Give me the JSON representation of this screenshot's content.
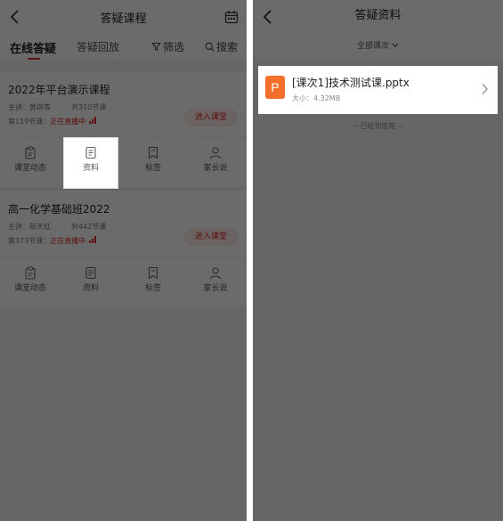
{
  "left": {
    "title": "答疑课程",
    "tabs": [
      "在线答疑",
      "答疑回放"
    ],
    "filter_label": "筛选",
    "search_label": "搜索",
    "courses": [
      {
        "title": "2022年平台演示课程",
        "teacher": "主讲：黄辟等",
        "total": "共310节课",
        "lesson": "第119节课：",
        "live": "正在直播中",
        "enter": "进入课堂"
      },
      {
        "title": "高一化学基础班2022",
        "teacher": "主讲：陈天虹",
        "total": "共442节课",
        "lesson": "第373节课：",
        "live": "正在直播中",
        "enter": "进入课堂"
      }
    ],
    "actions": [
      "课堂动态",
      "资料",
      "标签",
      "家长说"
    ],
    "highlighted_action": "资料"
  },
  "right": {
    "title": "答疑资料",
    "select_label": "全部课次",
    "file": {
      "icon_letter": "P",
      "name": "[课次1]技术测试课.pptx",
      "size": "大小：4.32MB"
    },
    "end_text": "-- 已经到底啦 --"
  },
  "colors": {
    "accent": "#e02424",
    "ppt_icon": "#f36f2a",
    "overlay": "rgba(0,0,0,0.58)"
  }
}
